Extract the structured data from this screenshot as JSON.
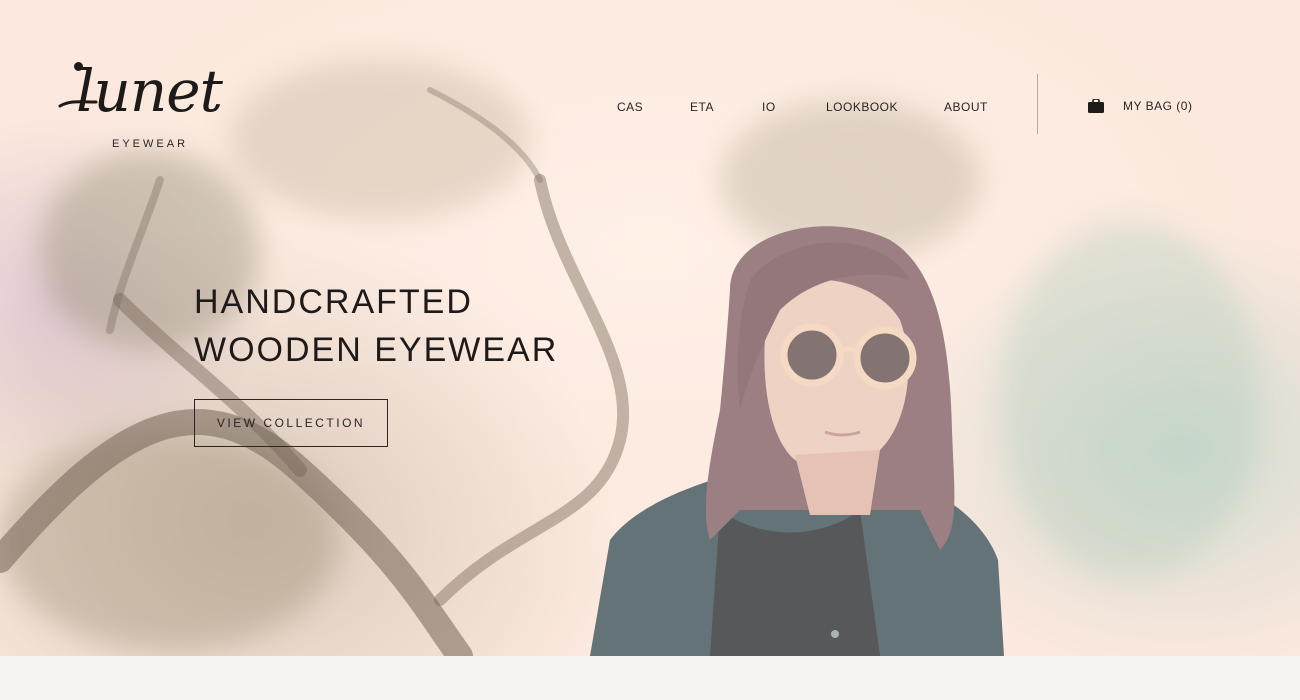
{
  "brand": {
    "logo_text": "lunet",
    "logo_subtitle": "EYEWEAR"
  },
  "nav": {
    "items": [
      {
        "label": "CAS"
      },
      {
        "label": "ETA"
      },
      {
        "label": "IO"
      },
      {
        "label": "LOOKBOOK"
      },
      {
        "label": "ABOUT"
      }
    ],
    "bag_label": "MY BAG (0)",
    "bag_icon": "shopping-bag-icon"
  },
  "hero": {
    "headline_line1": "HANDCRAFTED",
    "headline_line2": "WOODEN EYEWEAR",
    "cta_label": "VIEW COLLECTION"
  },
  "colors": {
    "text": "#1e1a1a",
    "hero_tint": "#fbe6dc",
    "footer_strip": "#f4f3f2"
  }
}
